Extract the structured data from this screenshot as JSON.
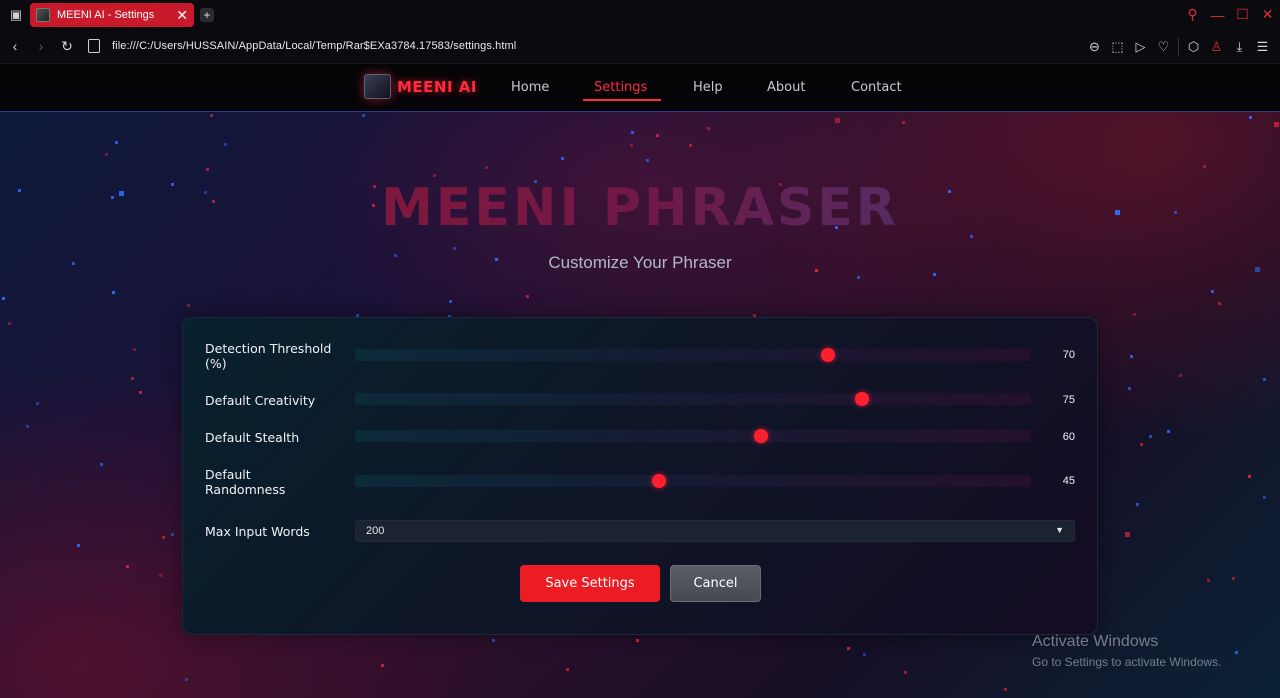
{
  "browser": {
    "tab_title": "MEENI AI - Settings",
    "url": "file:///C:/Users/HUSSAIN/AppData/Local/Temp/Rar$EXa3784.17583/settings.html"
  },
  "site": {
    "brand": "MEENI AI",
    "nav": [
      "Home",
      "Settings",
      "Help",
      "About",
      "Contact"
    ],
    "active_nav": "Settings"
  },
  "hero": {
    "title": "MEENI PHRASER",
    "subtitle": "Customize Your Phraser"
  },
  "settings": {
    "sliders": [
      {
        "label": "Detection Threshold (%)",
        "value": 70
      },
      {
        "label": "Default Creativity",
        "value": 75
      },
      {
        "label": "Default Stealth",
        "value": 60
      },
      {
        "label": "Default Randomness",
        "value": 45
      }
    ],
    "max_words_label": "Max Input Words",
    "max_words_value": "200",
    "save_label": "Save Settings",
    "cancel_label": "Cancel"
  },
  "watermark": {
    "line1": "Activate Windows",
    "line2": "Go to Settings to activate Windows."
  },
  "colors": {
    "accent": "#ff2b3d",
    "save_button": "#ec1c24"
  }
}
